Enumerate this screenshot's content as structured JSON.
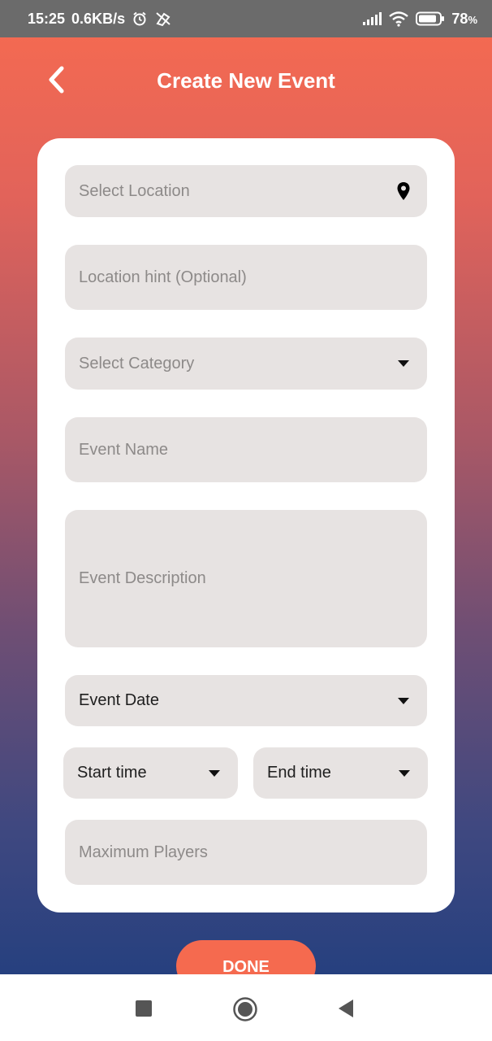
{
  "status_bar": {
    "time": "15:25",
    "net_speed": "0.6KB/s",
    "battery": "78",
    "battery_unit": "%",
    "icons": [
      "alarm-icon",
      "data-saver-icon",
      "signal-icon",
      "wifi-icon",
      "battery-icon"
    ]
  },
  "header": {
    "title": "Create New Event",
    "back_icon": "chevron-left-icon"
  },
  "form": {
    "location": {
      "placeholder": "Select Location",
      "icon": "map-pin-icon"
    },
    "location_hint": {
      "placeholder": "Location hint (Optional)"
    },
    "category": {
      "placeholder": "Select Category",
      "icon": "caret-down-icon"
    },
    "event_name": {
      "placeholder": "Event Name"
    },
    "event_description": {
      "placeholder": "Event Description"
    },
    "event_date": {
      "value": "Event Date",
      "icon": "caret-down-icon"
    },
    "start_time": {
      "value": "Start time",
      "icon": "caret-down-icon"
    },
    "end_time": {
      "value": "End time",
      "icon": "caret-down-icon"
    },
    "max_players": {
      "placeholder": "Maximum Players"
    }
  },
  "done_button": {
    "label": "DONE"
  },
  "nav_bar": {
    "icons": [
      "recents-square-icon",
      "home-circle-icon",
      "back-triangle-icon"
    ]
  },
  "colors": {
    "gradient_top": "#f76b50",
    "gradient_bottom": "#26407f",
    "accent": "#f56a4f",
    "field_bg": "#e7e3e2",
    "status_bar": "#6b6b6b"
  }
}
